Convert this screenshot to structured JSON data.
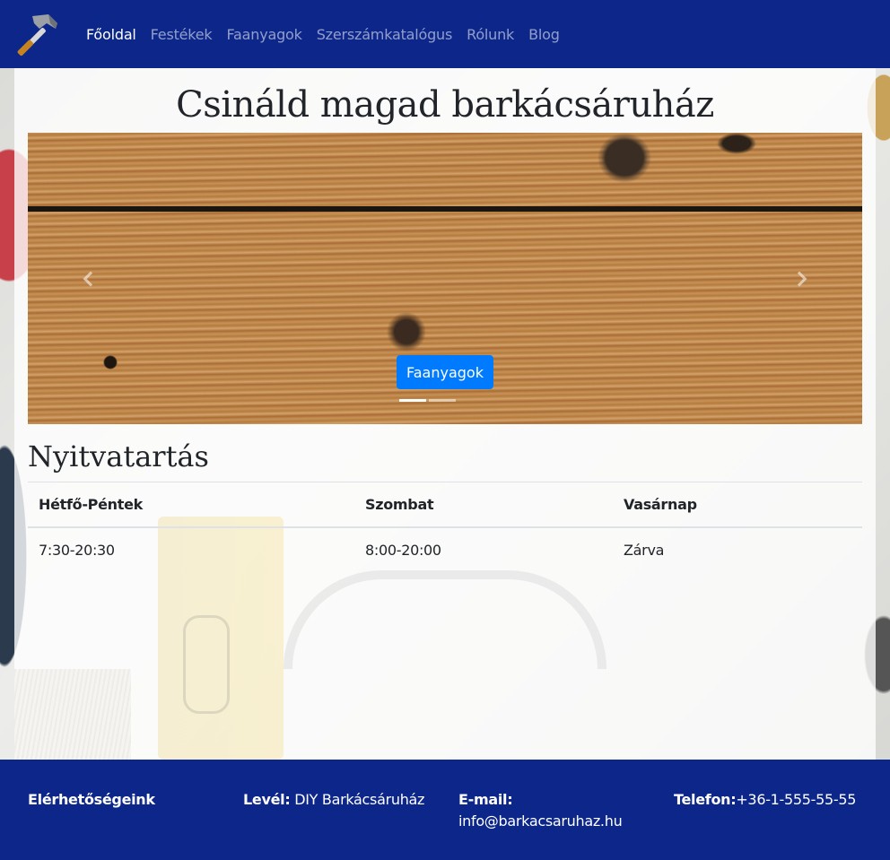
{
  "nav": {
    "links": [
      {
        "label": "Főoldal",
        "active": true
      },
      {
        "label": "Festékek",
        "active": false
      },
      {
        "label": "Faanyagok",
        "active": false
      },
      {
        "label": "Szerszámkatalógus",
        "active": false
      },
      {
        "label": "Rólunk",
        "active": false
      },
      {
        "label": "Blog",
        "active": false
      }
    ],
    "logo_icon": "hammer-icon"
  },
  "main": {
    "title": "Csináld magad barkácsáruház"
  },
  "carousel": {
    "caption_button": "Faanyagok",
    "slide_count": 2,
    "active_slide": 1
  },
  "hours": {
    "title": "Nyitvatartás",
    "headers": [
      "Hétfő-Péntek",
      "Szombat",
      "Vasárnap"
    ],
    "rows": [
      [
        "7:30-20:30",
        "8:00-20:00",
        "Zárva"
      ]
    ]
  },
  "footer": {
    "heading": "Elérhetőségeink",
    "mail_label": "Levél:",
    "mail_value": " DIY Barkácsáruház",
    "email_label": "E-mail:",
    "email_value": "info@barkacsaruhaz.hu",
    "phone_label": "Telefon:",
    "phone_value": "+36-1-555-55-55"
  },
  "colors": {
    "navbar": "#0c268a",
    "button": "#007bff"
  }
}
